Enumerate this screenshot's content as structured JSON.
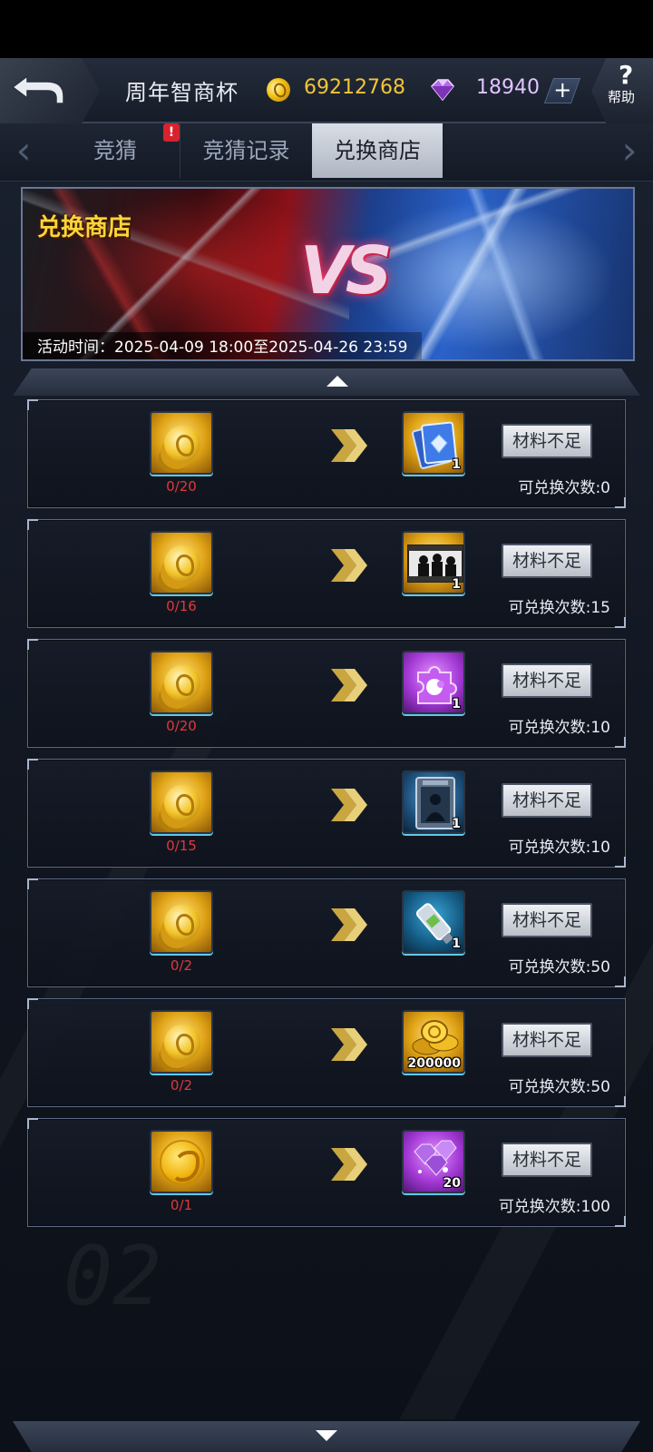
{
  "header": {
    "title": "周年智商杯",
    "coin_value": "69212768",
    "gem_value": "18940",
    "plus_label": "+",
    "help_symbol": "?",
    "help_label": "帮助"
  },
  "tabs": [
    {
      "label": "竞猜",
      "alert": "!"
    },
    {
      "label": "竞猜记录"
    },
    {
      "label": "兑换商店",
      "active": true
    }
  ],
  "banner": {
    "title": "兑换商店",
    "vs": "VS",
    "time": "活动时间：2025-04-09 18:00至2025-04-26 23:59"
  },
  "items": [
    {
      "cost": "0/20",
      "cost_icon": "coin-stack-icon",
      "reward_icon": "card-pack-icon",
      "reward_count": "1",
      "button": "材料不足",
      "remaining": "可兑换次数:0",
      "colors": {
        "reward_bg": "gold"
      }
    },
    {
      "cost": "0/16",
      "cost_icon": "coin-stack-icon",
      "reward_icon": "silhouette-card-icon",
      "reward_count": "1",
      "button": "材料不足",
      "remaining": "可兑换次数:15",
      "colors": {
        "reward_bg": "gold"
      }
    },
    {
      "cost": "0/20",
      "cost_icon": "coin-stack-icon",
      "reward_icon": "puzzle-piece-icon",
      "reward_count": "1",
      "button": "材料不足",
      "remaining": "可兑换次数:10",
      "colors": {
        "reward_bg": "purple"
      }
    },
    {
      "cost": "0/15",
      "cost_icon": "coin-stack-icon",
      "reward_icon": "target-card-icon",
      "reward_count": "1",
      "button": "材料不足",
      "remaining": "可兑换次数:10",
      "colors": {
        "reward_bg": "blue"
      }
    },
    {
      "cost": "0/2",
      "cost_icon": "coin-stack-icon",
      "reward_icon": "usb-drive-icon",
      "reward_count": "1",
      "button": "材料不足",
      "remaining": "可兑换次数:50",
      "colors": {
        "reward_bg": "teal"
      }
    },
    {
      "cost": "0/2",
      "cost_icon": "coin-stack-icon",
      "reward_icon": "gold-coins-icon",
      "reward_count": "200000",
      "button": "材料不足",
      "remaining": "可兑换次数:50",
      "colors": {
        "reward_bg": "gold"
      }
    },
    {
      "cost": "0/1",
      "cost_icon": "dragon-coin-icon",
      "reward_icon": "gems-icon",
      "reward_count": "20",
      "button": "材料不足",
      "remaining": "可兑换次数:100",
      "colors": {
        "reward_bg": "purple"
      }
    }
  ],
  "colors": {
    "coin": "#f3c43a",
    "gem": "#e2c3ff",
    "cost_red": "#e0393b",
    "alert_red": "#d8222e"
  }
}
